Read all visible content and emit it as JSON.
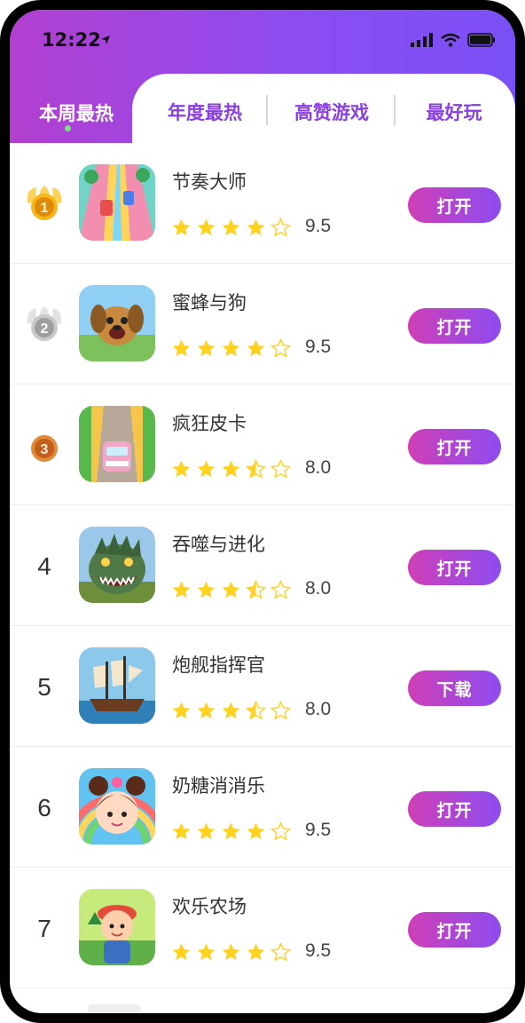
{
  "status_bar": {
    "time": "12:22"
  },
  "tabs": [
    {
      "label": "本周最热",
      "active": true
    },
    {
      "label": "年度最热",
      "active": false
    },
    {
      "label": "高赞游戏",
      "active": false
    },
    {
      "label": "最好玩",
      "active": false
    }
  ],
  "colors": {
    "header_start": "#b23fd0",
    "header_end": "#7a50f5",
    "tab_text": "#8a3fe0",
    "star": "#ffd21f",
    "button_start": "#cf3fb6",
    "button_end": "#8d4cf0"
  },
  "games": [
    {
      "rank": "1",
      "rank_badge": "gold-medal-icon",
      "name": "节奏大师",
      "rating": 4,
      "score": "9.5",
      "action": "打开",
      "thumb": "running-road-thumbnail"
    },
    {
      "rank": "2",
      "rank_badge": "silver-medal-icon",
      "name": "蜜蜂与狗",
      "rating": 4,
      "score": "9.5",
      "action": "打开",
      "thumb": "dog-thumbnail"
    },
    {
      "rank": "3",
      "rank_badge": "bronze-medal-icon",
      "name": "疯狂皮卡",
      "rating": 3.5,
      "score": "8.0",
      "action": "打开",
      "thumb": "pickup-car-thumbnail"
    },
    {
      "rank": "4",
      "rank_badge": "",
      "name": "吞噬与进化",
      "rating": 3.5,
      "score": "8.0",
      "action": "打开",
      "thumb": "monster-thumbnail"
    },
    {
      "rank": "5",
      "rank_badge": "",
      "name": "炮舰指挥官",
      "rating": 3.5,
      "score": "8.0",
      "action": "下载",
      "thumb": "pirate-ship-thumbnail"
    },
    {
      "rank": "6",
      "rank_badge": "",
      "name": "奶糖消消乐",
      "rating": 4,
      "score": "9.5",
      "action": "打开",
      "thumb": "girl-rainbow-thumbnail"
    },
    {
      "rank": "7",
      "rank_badge": "",
      "name": "欢乐农场",
      "rating": 4,
      "score": "9.5",
      "action": "打开",
      "thumb": "farm-boy-thumbnail"
    }
  ]
}
